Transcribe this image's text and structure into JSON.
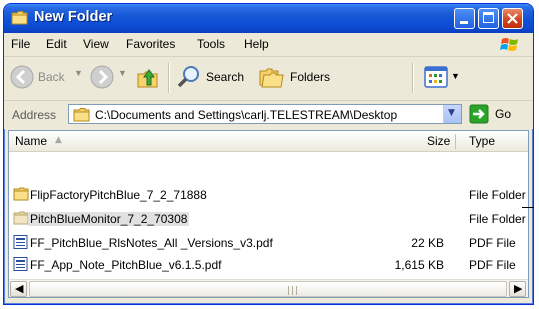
{
  "window": {
    "title": "New Folder",
    "title_icon": "folder-icon"
  },
  "menu": {
    "items": [
      "File",
      "Edit",
      "View",
      "Favorites",
      "Tools",
      "Help"
    ]
  },
  "toolbar": {
    "back_label": "Back",
    "search_label": "Search",
    "folders_label": "Folders"
  },
  "address": {
    "label": "Address",
    "value": "C:\\Documents and Settings\\carlj.TELESTREAM\\Desktop",
    "go_label": "Go"
  },
  "list": {
    "columns": {
      "name": "Name",
      "size": "Size",
      "type": "Type"
    },
    "rows": [
      {
        "name": "FlipFactoryPitchBlue_7_2_71888",
        "size": "",
        "type": "File Folder",
        "icon": "folder-icon",
        "selected": false
      },
      {
        "name": "PitchBlueMonitor_7_2_70308",
        "size": "",
        "type": "File Folder",
        "icon": "folder-icon",
        "selected": true
      },
      {
        "name": "FF_PitchBlue_RlsNotes_All _Versions_v3.pdf",
        "size": "22 KB",
        "type": "PDF File",
        "icon": "pdf-file-icon",
        "selected": false
      },
      {
        "name": "FF_App_Note_PitchBlue_v6.1.5.pdf",
        "size": "1,615 KB",
        "type": "PDF File",
        "icon": "pdf-file-icon",
        "selected": false
      }
    ]
  },
  "colors": {
    "titlebar": "#0f52d8",
    "selection": "#e1e1e1",
    "go_green": "#2aa52a"
  }
}
